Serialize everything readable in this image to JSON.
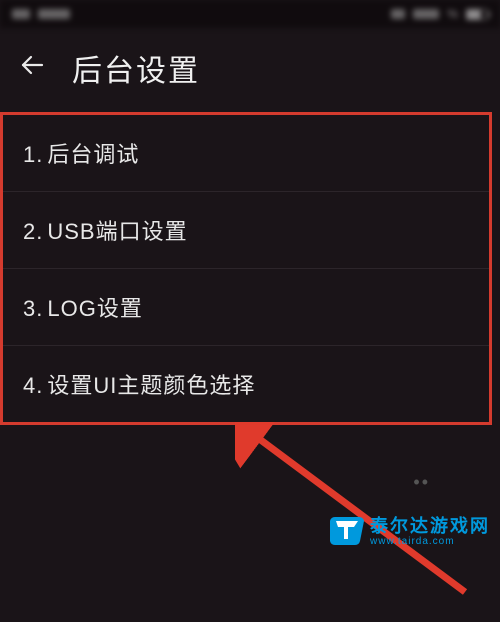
{
  "status": {
    "percent_symbol": "%"
  },
  "header": {
    "title": "后台设置"
  },
  "menu": {
    "items": [
      {
        "num": "1.",
        "label": "后台调试"
      },
      {
        "num": "2.",
        "label": "USB端口设置"
      },
      {
        "num": "3.",
        "label": "LOG设置"
      },
      {
        "num": "4.",
        "label": "设置UI主题颜色选择"
      }
    ]
  },
  "watermark": {
    "brand": "泰尔达游戏网",
    "domain": "www.tairda.com"
  },
  "colors": {
    "highlight_border": "#d43b2e",
    "arrow": "#e03a2c",
    "brand": "#0099dd"
  }
}
